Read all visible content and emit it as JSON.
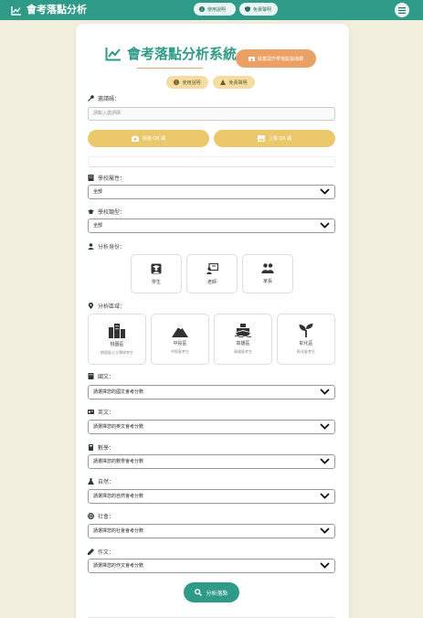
{
  "brand": {
    "title": "會考落點分析"
  },
  "topnav": {
    "guide": "使用說明",
    "disclaimer": "免責聲明"
  },
  "header": {
    "title": "會考落點分析系統",
    "recommend_button": "就業與升學落點指導網",
    "guide_pill": "使用說明",
    "disclaimer_pill": "免責聲明"
  },
  "invite": {
    "label": "邀請碼：",
    "placeholder": "請輸入邀請碼",
    "scan_button": "掃描 QR 碼",
    "upload_button": "上傳 QR 碼"
  },
  "school_ownership": {
    "label": "學校屬性：",
    "value": "全部"
  },
  "school_type": {
    "label": "學校類型：",
    "value": "全部"
  },
  "identity": {
    "label": "分析身份：",
    "options": [
      "學生",
      "老師",
      "家長"
    ]
  },
  "region": {
    "label": "分析區域：",
    "options": [
      {
        "name": "桃園區",
        "desc": "桃園區公立學校考生"
      },
      {
        "name": "中投區",
        "desc": "中投區考生"
      },
      {
        "name": "高雄區",
        "desc": "高雄區考生"
      },
      {
        "name": "彰化區",
        "desc": "彰化區考生"
      }
    ]
  },
  "subjects": [
    {
      "label": "國文：",
      "placeholder": "請選擇您的國文會考分數",
      "icon": "book-icon"
    },
    {
      "label": "英文：",
      "placeholder": "請選擇您的英文會考分數",
      "icon": "language-icon"
    },
    {
      "label": "數學：",
      "placeholder": "請選擇您的數學會考分數",
      "icon": "calculator-icon"
    },
    {
      "label": "自然：",
      "placeholder": "請選擇您的自然會考分數",
      "icon": "flask-icon"
    },
    {
      "label": "社會：",
      "placeholder": "請選擇您的社會會考分數",
      "icon": "globe-icon"
    },
    {
      "label": "作文：",
      "placeholder": "請選擇您的作文會考分數",
      "icon": "pen-icon"
    }
  ],
  "analyze_button": "分析落點",
  "colors": {
    "primary": "#2e9a87",
    "accent": "#eba066",
    "gold": "#ebc86b",
    "background": "#f2eedd"
  }
}
